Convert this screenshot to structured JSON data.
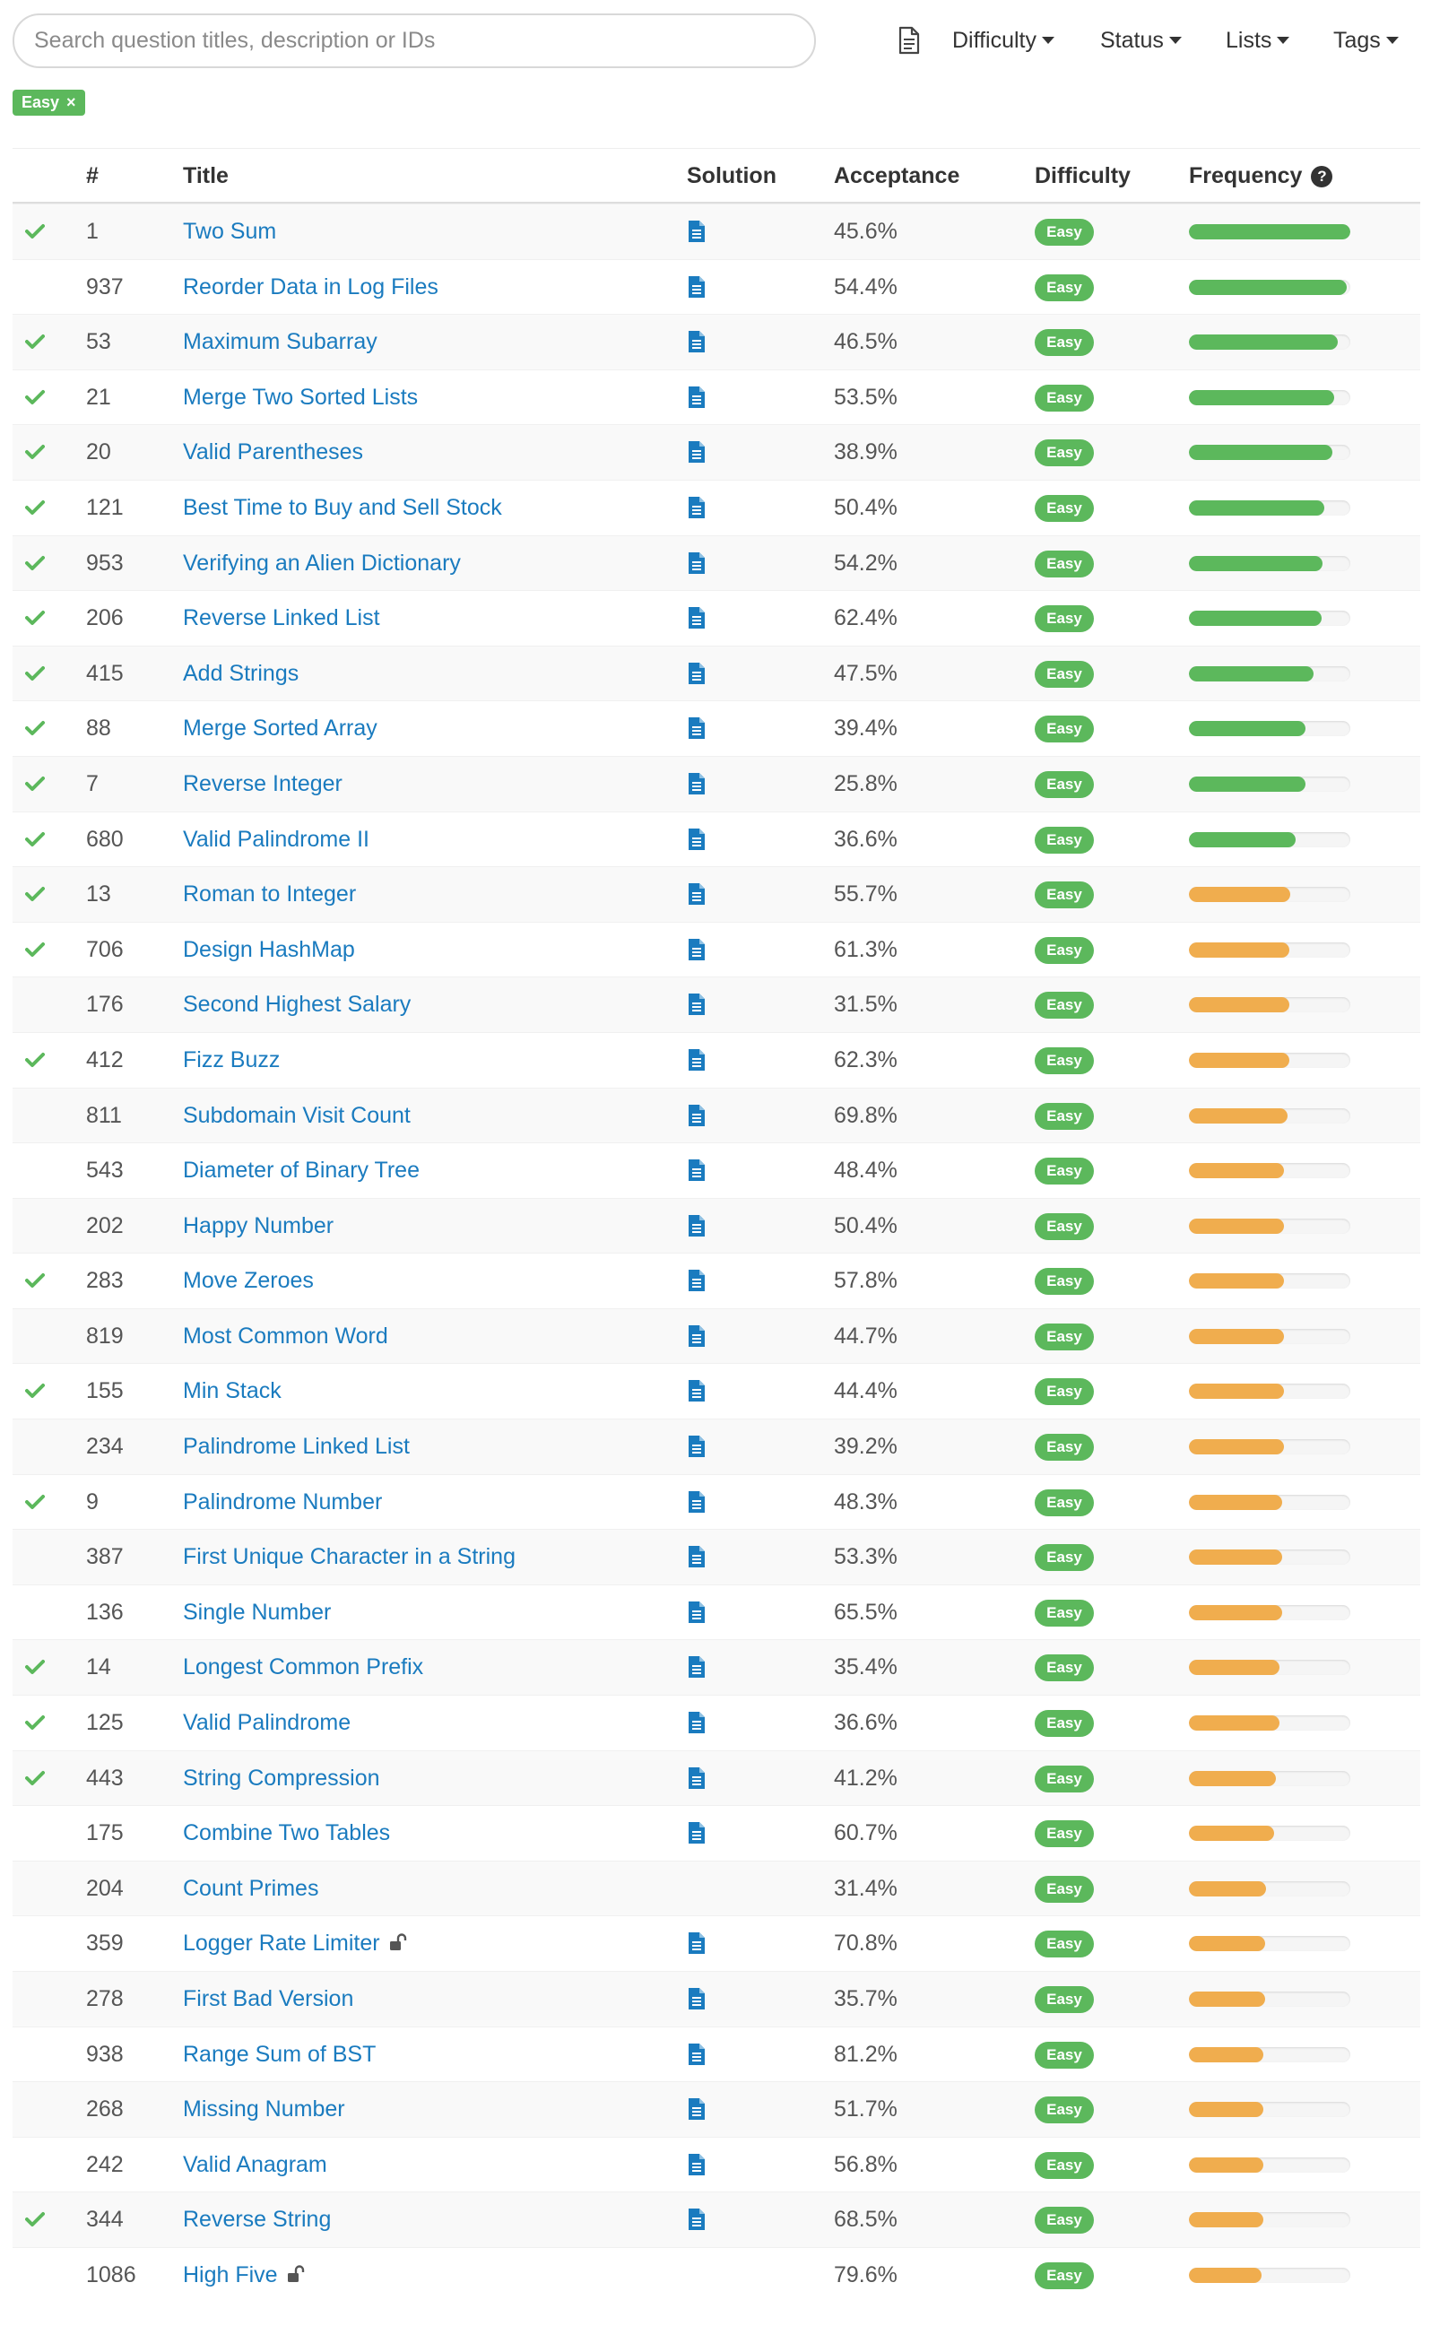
{
  "search": {
    "placeholder": "Search question titles, description or IDs"
  },
  "filters": {
    "difficulty": "Difficulty",
    "status": "Status",
    "lists": "Lists",
    "tags": "Tags"
  },
  "active_filter": {
    "label": "Easy",
    "remove": "×"
  },
  "columns": {
    "num": "#",
    "title": "Title",
    "solution": "Solution",
    "acceptance": "Acceptance",
    "difficulty": "Difficulty",
    "frequency": "Frequency",
    "help": "?"
  },
  "colors": {
    "link": "#1a7bbf",
    "easy": "#5cb85c",
    "freq_high": "#5cb85c",
    "freq_mid": "#f0ad4e",
    "check": "#5cb85c"
  },
  "rows": [
    {
      "solved": true,
      "id": "1",
      "title": "Two Sum",
      "locked": false,
      "solution": true,
      "acceptance": "45.6%",
      "difficulty": "Easy",
      "frequency": 1.0,
      "tier": "green"
    },
    {
      "solved": false,
      "id": "937",
      "title": "Reorder Data in Log Files",
      "locked": false,
      "solution": true,
      "acceptance": "54.4%",
      "difficulty": "Easy",
      "frequency": 0.98,
      "tier": "green"
    },
    {
      "solved": true,
      "id": "53",
      "title": "Maximum Subarray",
      "locked": false,
      "solution": true,
      "acceptance": "46.5%",
      "difficulty": "Easy",
      "frequency": 0.92,
      "tier": "green"
    },
    {
      "solved": true,
      "id": "21",
      "title": "Merge Two Sorted Lists",
      "locked": false,
      "solution": true,
      "acceptance": "53.5%",
      "difficulty": "Easy",
      "frequency": 0.9,
      "tier": "green"
    },
    {
      "solved": true,
      "id": "20",
      "title": "Valid Parentheses",
      "locked": false,
      "solution": true,
      "acceptance": "38.9%",
      "difficulty": "Easy",
      "frequency": 0.89,
      "tier": "green"
    },
    {
      "solved": true,
      "id": "121",
      "title": "Best Time to Buy and Sell Stock",
      "locked": false,
      "solution": true,
      "acceptance": "50.4%",
      "difficulty": "Easy",
      "frequency": 0.84,
      "tier": "green"
    },
    {
      "solved": true,
      "id": "953",
      "title": "Verifying an Alien Dictionary",
      "locked": false,
      "solution": true,
      "acceptance": "54.2%",
      "difficulty": "Easy",
      "frequency": 0.83,
      "tier": "green"
    },
    {
      "solved": true,
      "id": "206",
      "title": "Reverse Linked List",
      "locked": false,
      "solution": true,
      "acceptance": "62.4%",
      "difficulty": "Easy",
      "frequency": 0.82,
      "tier": "green"
    },
    {
      "solved": true,
      "id": "415",
      "title": "Add Strings",
      "locked": false,
      "solution": true,
      "acceptance": "47.5%",
      "difficulty": "Easy",
      "frequency": 0.77,
      "tier": "green"
    },
    {
      "solved": true,
      "id": "88",
      "title": "Merge Sorted Array",
      "locked": false,
      "solution": true,
      "acceptance": "39.4%",
      "difficulty": "Easy",
      "frequency": 0.72,
      "tier": "green"
    },
    {
      "solved": true,
      "id": "7",
      "title": "Reverse Integer",
      "locked": false,
      "solution": true,
      "acceptance": "25.8%",
      "difficulty": "Easy",
      "frequency": 0.72,
      "tier": "green"
    },
    {
      "solved": true,
      "id": "680",
      "title": "Valid Palindrome II",
      "locked": false,
      "solution": true,
      "acceptance": "36.6%",
      "difficulty": "Easy",
      "frequency": 0.66,
      "tier": "green"
    },
    {
      "solved": true,
      "id": "13",
      "title": "Roman to Integer",
      "locked": false,
      "solution": true,
      "acceptance": "55.7%",
      "difficulty": "Easy",
      "frequency": 0.63,
      "tier": "orange"
    },
    {
      "solved": true,
      "id": "706",
      "title": "Design HashMap",
      "locked": false,
      "solution": true,
      "acceptance": "61.3%",
      "difficulty": "Easy",
      "frequency": 0.62,
      "tier": "orange"
    },
    {
      "solved": false,
      "id": "176",
      "title": "Second Highest Salary",
      "locked": false,
      "solution": true,
      "acceptance": "31.5%",
      "difficulty": "Easy",
      "frequency": 0.62,
      "tier": "orange"
    },
    {
      "solved": true,
      "id": "412",
      "title": "Fizz Buzz",
      "locked": false,
      "solution": true,
      "acceptance": "62.3%",
      "difficulty": "Easy",
      "frequency": 0.62,
      "tier": "orange"
    },
    {
      "solved": false,
      "id": "811",
      "title": "Subdomain Visit Count",
      "locked": false,
      "solution": true,
      "acceptance": "69.8%",
      "difficulty": "Easy",
      "frequency": 0.61,
      "tier": "orange"
    },
    {
      "solved": false,
      "id": "543",
      "title": "Diameter of Binary Tree",
      "locked": false,
      "solution": true,
      "acceptance": "48.4%",
      "difficulty": "Easy",
      "frequency": 0.59,
      "tier": "orange"
    },
    {
      "solved": false,
      "id": "202",
      "title": "Happy Number",
      "locked": false,
      "solution": true,
      "acceptance": "50.4%",
      "difficulty": "Easy",
      "frequency": 0.59,
      "tier": "orange"
    },
    {
      "solved": true,
      "id": "283",
      "title": "Move Zeroes",
      "locked": false,
      "solution": true,
      "acceptance": "57.8%",
      "difficulty": "Easy",
      "frequency": 0.59,
      "tier": "orange"
    },
    {
      "solved": false,
      "id": "819",
      "title": "Most Common Word",
      "locked": false,
      "solution": true,
      "acceptance": "44.7%",
      "difficulty": "Easy",
      "frequency": 0.59,
      "tier": "orange"
    },
    {
      "solved": true,
      "id": "155",
      "title": "Min Stack",
      "locked": false,
      "solution": true,
      "acceptance": "44.4%",
      "difficulty": "Easy",
      "frequency": 0.59,
      "tier": "orange"
    },
    {
      "solved": false,
      "id": "234",
      "title": "Palindrome Linked List",
      "locked": false,
      "solution": true,
      "acceptance": "39.2%",
      "difficulty": "Easy",
      "frequency": 0.59,
      "tier": "orange"
    },
    {
      "solved": true,
      "id": "9",
      "title": "Palindrome Number",
      "locked": false,
      "solution": true,
      "acceptance": "48.3%",
      "difficulty": "Easy",
      "frequency": 0.58,
      "tier": "orange"
    },
    {
      "solved": false,
      "id": "387",
      "title": "First Unique Character in a String",
      "locked": false,
      "solution": true,
      "acceptance": "53.3%",
      "difficulty": "Easy",
      "frequency": 0.58,
      "tier": "orange"
    },
    {
      "solved": false,
      "id": "136",
      "title": "Single Number",
      "locked": false,
      "solution": true,
      "acceptance": "65.5%",
      "difficulty": "Easy",
      "frequency": 0.58,
      "tier": "orange"
    },
    {
      "solved": true,
      "id": "14",
      "title": "Longest Common Prefix",
      "locked": false,
      "solution": true,
      "acceptance": "35.4%",
      "difficulty": "Easy",
      "frequency": 0.56,
      "tier": "orange"
    },
    {
      "solved": true,
      "id": "125",
      "title": "Valid Palindrome",
      "locked": false,
      "solution": true,
      "acceptance": "36.6%",
      "difficulty": "Easy",
      "frequency": 0.56,
      "tier": "orange"
    },
    {
      "solved": true,
      "id": "443",
      "title": "String Compression",
      "locked": false,
      "solution": true,
      "acceptance": "41.2%",
      "difficulty": "Easy",
      "frequency": 0.54,
      "tier": "orange"
    },
    {
      "solved": false,
      "id": "175",
      "title": "Combine Two Tables",
      "locked": false,
      "solution": true,
      "acceptance": "60.7%",
      "difficulty": "Easy",
      "frequency": 0.53,
      "tier": "orange"
    },
    {
      "solved": false,
      "id": "204",
      "title": "Count Primes",
      "locked": false,
      "solution": false,
      "acceptance": "31.4%",
      "difficulty": "Easy",
      "frequency": 0.48,
      "tier": "orange"
    },
    {
      "solved": false,
      "id": "359",
      "title": "Logger Rate Limiter",
      "locked": true,
      "solution": true,
      "acceptance": "70.8%",
      "difficulty": "Easy",
      "frequency": 0.47,
      "tier": "orange"
    },
    {
      "solved": false,
      "id": "278",
      "title": "First Bad Version",
      "locked": false,
      "solution": true,
      "acceptance": "35.7%",
      "difficulty": "Easy",
      "frequency": 0.47,
      "tier": "orange"
    },
    {
      "solved": false,
      "id": "938",
      "title": "Range Sum of BST",
      "locked": false,
      "solution": true,
      "acceptance": "81.2%",
      "difficulty": "Easy",
      "frequency": 0.46,
      "tier": "orange"
    },
    {
      "solved": false,
      "id": "268",
      "title": "Missing Number",
      "locked": false,
      "solution": true,
      "acceptance": "51.7%",
      "difficulty": "Easy",
      "frequency": 0.46,
      "tier": "orange"
    },
    {
      "solved": false,
      "id": "242",
      "title": "Valid Anagram",
      "locked": false,
      "solution": true,
      "acceptance": "56.8%",
      "difficulty": "Easy",
      "frequency": 0.46,
      "tier": "orange"
    },
    {
      "solved": true,
      "id": "344",
      "title": "Reverse String",
      "locked": false,
      "solution": true,
      "acceptance": "68.5%",
      "difficulty": "Easy",
      "frequency": 0.46,
      "tier": "orange"
    },
    {
      "solved": false,
      "id": "1086",
      "title": "High Five",
      "locked": true,
      "solution": false,
      "acceptance": "79.6%",
      "difficulty": "Easy",
      "frequency": 0.45,
      "tier": "orange"
    }
  ]
}
